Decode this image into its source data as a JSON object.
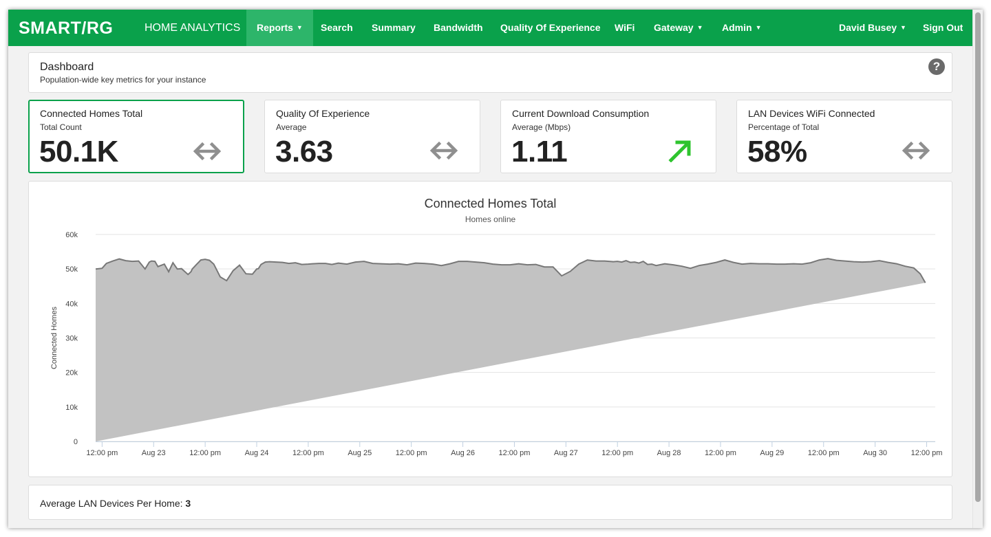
{
  "navbar": {
    "brand": "SMART/RG",
    "app_title": "HOME ANALYTICS",
    "items": [
      {
        "label": "Reports",
        "dropdown": true,
        "active": true
      },
      {
        "label": "Search",
        "dropdown": false
      },
      {
        "label": "Summary",
        "dropdown": false
      },
      {
        "label": "Bandwidth",
        "dropdown": false
      },
      {
        "label": "Quality Of Experience",
        "dropdown": false
      },
      {
        "label": "WiFi",
        "dropdown": false
      },
      {
        "label": "Gateway",
        "dropdown": true
      },
      {
        "label": "Admin",
        "dropdown": true
      }
    ],
    "user": "David Busey",
    "signout": "Sign Out",
    "color": "#0aa14b"
  },
  "dashboard": {
    "title": "Dashboard",
    "subtitle": "Population-wide key metrics for your instance",
    "help_icon": "?"
  },
  "cards": [
    {
      "title": "Connected Homes Total",
      "subtitle": "Total Count",
      "value": "50.1K",
      "trend": "flat",
      "icon": "double-arrow-icon"
    },
    {
      "title": "Quality Of Experience",
      "subtitle": "Average",
      "value": "3.63",
      "trend": "flat",
      "icon": "double-arrow-icon"
    },
    {
      "title": "Current Download Consumption",
      "subtitle": "Average (Mbps)",
      "value": "1.11",
      "trend": "up",
      "icon": "up-arrow-icon"
    },
    {
      "title": "LAN Devices WiFi Connected",
      "subtitle": "Percentage of Total",
      "value": "58%",
      "trend": "flat",
      "icon": "double-arrow-icon"
    }
  ],
  "chart_data": {
    "type": "area",
    "title": "Connected Homes Total",
    "subtitle": "Homes online",
    "ylabel": "Connected Homes",
    "xlabel": "",
    "ylim": [
      0,
      60000
    ],
    "yticks": [
      "0",
      "10k",
      "20k",
      "30k",
      "40k",
      "50k",
      "60k"
    ],
    "xticks": [
      "12:00 pm",
      "Aug 23",
      "12:00 pm",
      "Aug 24",
      "12:00 pm",
      "Aug 25",
      "12:00 pm",
      "Aug 26",
      "12:00 pm",
      "Aug 27",
      "12:00 pm",
      "Aug 28",
      "12:00 pm",
      "Aug 29",
      "12:00 pm",
      "Aug 30",
      "12:00 pm"
    ],
    "xlim_hours": [
      -1.5,
      194
    ],
    "grid": true,
    "legend": "none",
    "fill_color": "#c2c2c2",
    "line_color": "#777777",
    "series": [
      {
        "x_hours": [
          -1.5,
          0,
          1,
          2.5,
          4,
          5.5,
          7,
          8.5,
          10,
          11,
          11.5,
          12.3,
          13,
          14.5,
          15.5,
          16.5,
          17.5,
          18.5,
          20,
          20.7,
          21,
          22,
          23,
          24,
          25,
          26,
          27.5,
          29,
          30.5,
          32,
          33.5,
          35,
          36,
          36.4,
          37,
          38,
          39,
          40.5,
          42,
          43.5,
          45,
          46.5,
          48,
          49,
          50.5,
          52,
          53.5,
          55,
          57,
          59,
          61,
          63,
          65,
          67,
          69,
          71,
          73,
          75,
          77,
          79,
          81,
          83,
          85,
          87,
          89,
          91,
          93,
          95,
          97,
          99,
          101,
          103,
          105,
          107,
          109,
          111,
          113,
          115,
          117,
          119,
          120,
          121,
          122,
          123,
          124,
          125,
          126,
          127,
          128,
          129,
          131,
          133,
          135,
          137,
          139,
          141,
          143,
          145,
          147,
          149,
          151,
          153,
          155,
          157,
          159,
          161,
          163,
          165,
          167,
          169,
          171,
          173,
          175,
          177,
          179,
          181,
          183,
          185,
          187,
          189,
          190.5,
          191.7,
          192.5,
          193
        ],
        "values": [
          50000,
          50200,
          51600,
          52300,
          52900,
          52400,
          52200,
          52300,
          50000,
          52000,
          52300,
          52200,
          50700,
          51400,
          49200,
          51800,
          50000,
          50100,
          48400,
          49200,
          50000,
          51300,
          52600,
          52800,
          52500,
          51400,
          47700,
          46600,
          49500,
          51100,
          48600,
          48500,
          50000,
          50100,
          51300,
          52000,
          52100,
          52000,
          51900,
          51600,
          51800,
          51300,
          51400,
          51500,
          51600,
          51600,
          51300,
          51700,
          51400,
          52000,
          52200,
          51600,
          51500,
          51400,
          51500,
          51200,
          51700,
          51600,
          51400,
          51000,
          51500,
          52200,
          52200,
          52000,
          51800,
          51400,
          51200,
          51200,
          51500,
          51200,
          51300,
          50600,
          50600,
          48000,
          49300,
          51400,
          52600,
          52300,
          52300,
          52100,
          52200,
          52000,
          52400,
          51900,
          52000,
          51700,
          52200,
          51300,
          51400,
          51000,
          51500,
          51200,
          50800,
          50200,
          51000,
          51400,
          51900,
          52600,
          51900,
          51400,
          51600,
          51500,
          51500,
          51400,
          51400,
          51500,
          51400,
          51800,
          52600,
          53000,
          52500,
          52300,
          52100,
          52000,
          52100,
          52400,
          51900,
          51500,
          50800,
          50300,
          48600,
          46000
        ]
      }
    ]
  },
  "footer": {
    "label": "Average LAN Devices Per Home:",
    "value": "3"
  }
}
